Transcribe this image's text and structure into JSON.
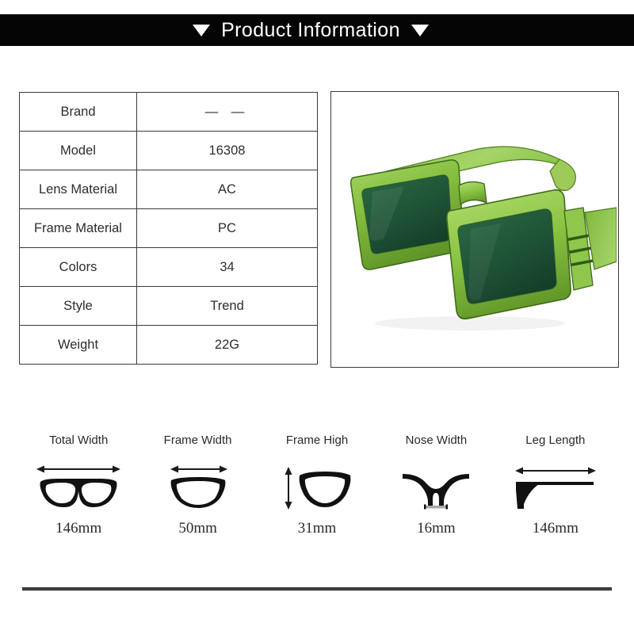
{
  "header": {
    "title": "Product Information",
    "left_icon": "triangle-down-icon",
    "right_icon": "triangle-down-icon",
    "background_color": "#050505",
    "text_color": "#ffffff"
  },
  "spec_table": {
    "rows": [
      {
        "key": "Brand",
        "value": "— —"
      },
      {
        "key": "Model",
        "value": "16308"
      },
      {
        "key": "Lens Material",
        "value": "AC"
      },
      {
        "key": "Frame Material",
        "value": "PC"
      },
      {
        "key": "Colors",
        "value": "34"
      },
      {
        "key": "Style",
        "value": "Trend"
      },
      {
        "key": "Weight",
        "value": "22G"
      }
    ]
  },
  "product_image": {
    "alt": "green rectangular sunglasses three-quarter view",
    "frame_color": "#7db83a",
    "frame_color_light": "#9fd15c",
    "frame_color_dark": "#4f7d22",
    "lens_color": "#1d5438",
    "border_color": "#3a3a3a"
  },
  "measurements": [
    {
      "label": "Total Width",
      "value": "146mm",
      "icon": "glasses-front-icon",
      "arrow": "horizontal"
    },
    {
      "label": "Frame Width",
      "value": "50mm",
      "icon": "lens-outline-icon",
      "arrow": "horizontal"
    },
    {
      "label": "Frame High",
      "value": "31mm",
      "icon": "lens-outline-icon",
      "arrow": "vertical"
    },
    {
      "label": "Nose Width",
      "value": "16mm",
      "icon": "nose-bridge-icon",
      "arrow": "bar"
    },
    {
      "label": "Leg Length",
      "value": "146mm",
      "icon": "temple-arm-icon",
      "arrow": "horizontal"
    }
  ],
  "divider": {
    "color": "#3d3d3d"
  }
}
